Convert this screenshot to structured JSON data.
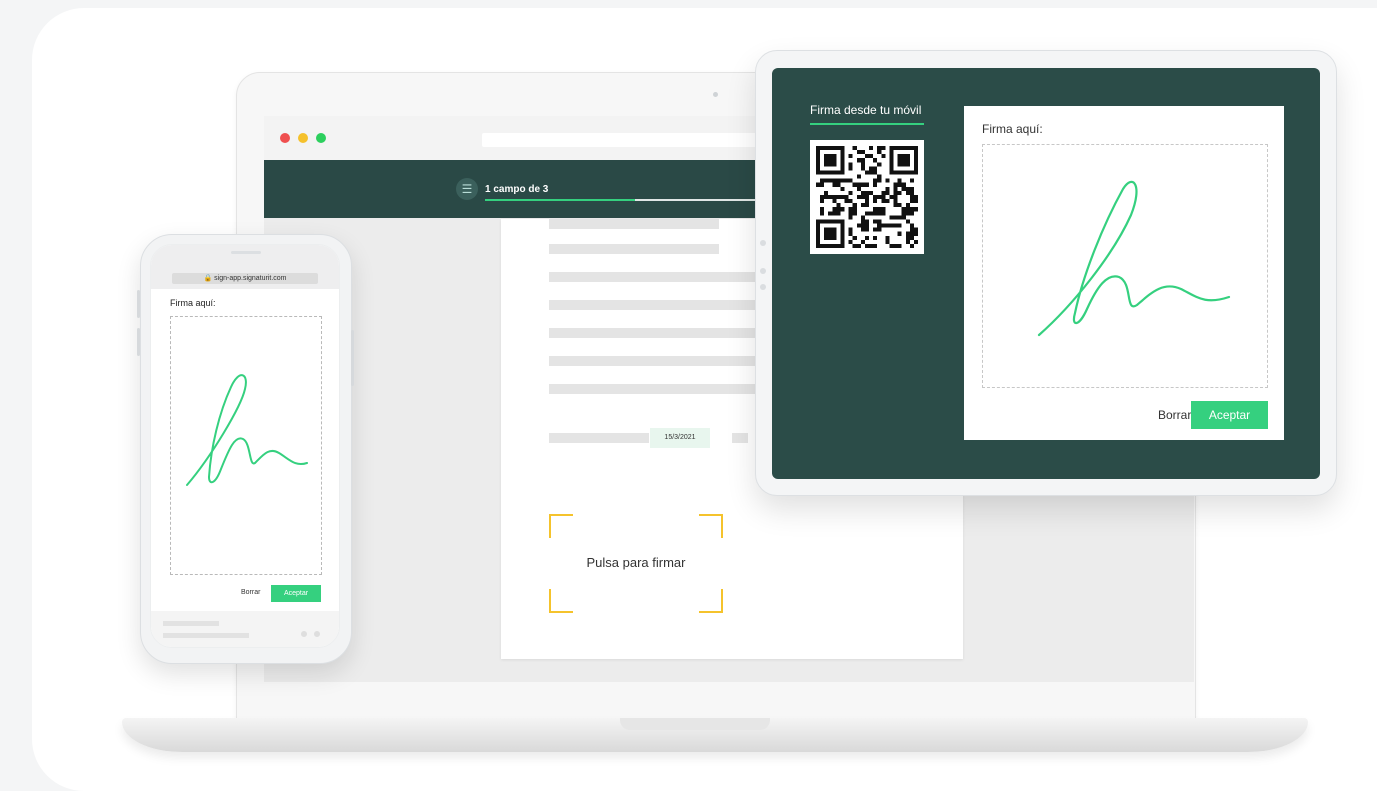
{
  "laptop": {
    "app_header": {
      "menu_icon_glyph": "☰",
      "step_label": "1 campo de 3",
      "progress_fraction": 0.25
    },
    "document": {
      "date_value": "15/3/2021",
      "sign_prompt": "Pulsa para firmar"
    }
  },
  "phone": {
    "url": "🔒 sign-app.signaturit.com",
    "sign_label": "Firma aquí:",
    "clear_button": "Borrar",
    "accept_button": "Aceptar"
  },
  "tablet": {
    "mobile_title": "Firma desde tu móvil",
    "sign_label": "Firma aquí:",
    "clear_button": "Borrar",
    "accept_button": "Aceptar"
  },
  "colors": {
    "accent_green": "#35d07f",
    "header_dark": "#2a4946",
    "tablet_bg": "#2b4c48",
    "corner_yellow": "#f5c32c"
  }
}
